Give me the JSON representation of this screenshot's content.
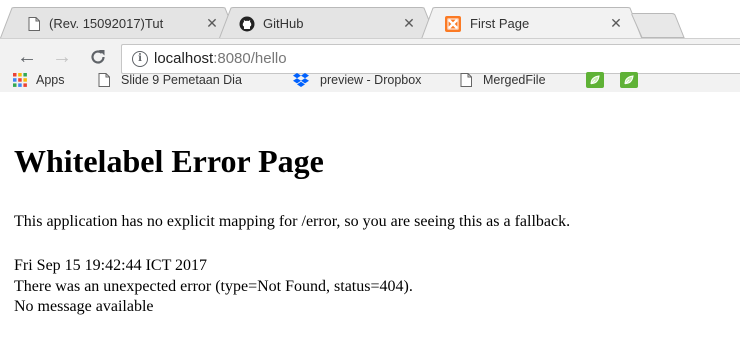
{
  "tabs": [
    {
      "title": "(Rev. 15092017)Tut",
      "icon": "page-icon",
      "active": false
    },
    {
      "title": "GitHub",
      "icon": "github-icon",
      "active": false
    },
    {
      "title": "First Page",
      "icon": "xampp-icon",
      "active": true
    }
  ],
  "toolbar": {
    "url_host": "localhost",
    "url_rest": ":8080/hello"
  },
  "bookmarks": [
    {
      "label": "Apps",
      "icon": "apps-grid-icon"
    },
    {
      "label": "Slide 9 Pemetaan Dia",
      "icon": "page-icon"
    },
    {
      "label": "preview - Dropbox",
      "icon": "dropbox-icon"
    },
    {
      "label": "MergedFile",
      "icon": "page-icon"
    },
    {
      "label": "",
      "icon": "leaf-icon"
    },
    {
      "label": "",
      "icon": "leaf-icon"
    }
  ],
  "page": {
    "heading": "Whitelabel Error Page",
    "intro": "This application has no explicit mapping for /error, so you are seeing this as a fallback.",
    "timestamp": "Fri Sep 15 19:42:44 ICT 2017",
    "error_line": "There was an unexpected error (type=Not Found, status=404).",
    "message": "No message available"
  },
  "colors": {
    "toolbar_bg": "#f2f2f2",
    "active_tab_bg": "#f2f2f2",
    "inactive_tab_bg": "#e4e4e4",
    "xampp_orange": "#fb7a24",
    "dropbox_blue": "#0061fe",
    "leaf_green": "#5fb236"
  }
}
